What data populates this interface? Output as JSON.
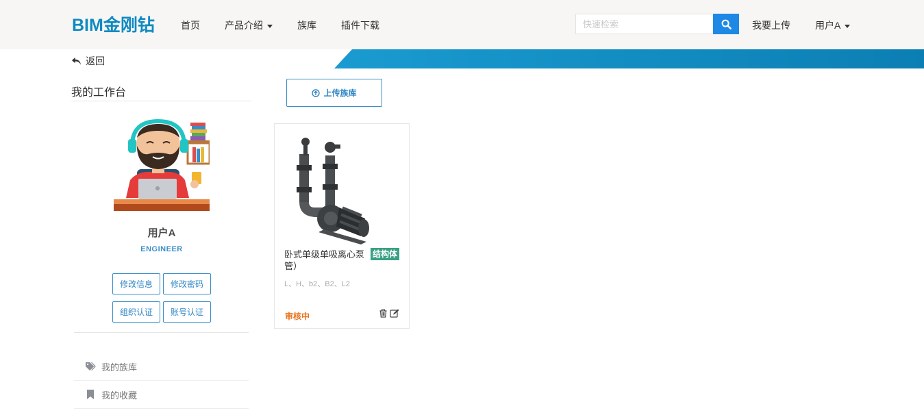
{
  "nav": {
    "brand": "BIM金刚钻",
    "home": "首页",
    "products": "产品介绍",
    "family_lib": "族库",
    "plugin_download": "插件下载",
    "search_placeholder": "快速检索",
    "upload": "我要上传",
    "user": "用户A"
  },
  "back_label": "返回",
  "sidebar": {
    "title": "我的工作台",
    "user_name": "用户A",
    "user_role": "ENGINEER",
    "buttons": {
      "edit_info": "修改信息",
      "change_password": "修改密码",
      "org_verify": "组织认证",
      "account_verify": "账号认证"
    },
    "menu": [
      {
        "label": "我的族库",
        "icon": "tags-icon"
      },
      {
        "label": "我的收藏",
        "icon": "bookmark-icon"
      }
    ]
  },
  "main": {
    "upload_button": "上传族库",
    "cards": [
      {
        "title": "卧式单级单吸离心泵（带接管）",
        "tag": "结构体",
        "params": "L、H、b2、B2、L2",
        "status": "审核中"
      }
    ]
  },
  "colors": {
    "brand": "#0e8ac1",
    "accent_blue": "#1e88e5",
    "tag_green": "#3a9f84",
    "status_orange": "#e8731c"
  }
}
